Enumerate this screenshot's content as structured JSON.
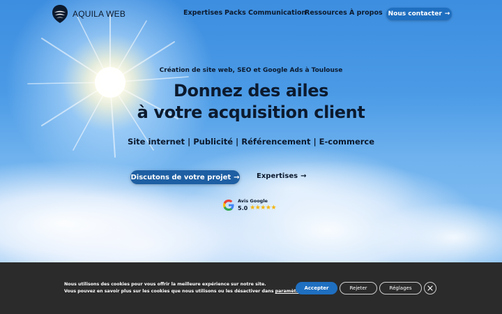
{
  "brand": {
    "name": "AQUILA WEB",
    "logo_icon": "eagle-shield-logo"
  },
  "nav": {
    "items": [
      {
        "label": "Expertises"
      },
      {
        "label": "Packs Communication"
      },
      {
        "label": "Ressources"
      },
      {
        "label": "À propos"
      }
    ],
    "contact_label": "Nous contacter",
    "contact_arrow": "→"
  },
  "hero": {
    "kicker": "Création de site web, SEO et Google Ads à Toulouse",
    "headline_line1": "Donnez des ailes",
    "headline_line2": "à votre acquisition client",
    "services": "Site internet | Publicité | Référencement | E-commerce",
    "cta_primary": "Discutons de votre projet",
    "cta_primary_arrow": "→",
    "cta_secondary": "Expertises",
    "cta_secondary_arrow": "→"
  },
  "review": {
    "label": "Avis Google",
    "score": "5.0",
    "stars": "★★★★★",
    "icon": "google-icon"
  },
  "cookie": {
    "line1": "Nous utilisons des cookies pour vous offrir la meilleure expérience sur notre site.",
    "line2_prefix": "Vous pouvez en savoir plus sur les cookies que nous utilisons ou les désactiver dans",
    "line2_link": "paramètres",
    "line2_suffix": ".",
    "accept_label": "Accepter",
    "reject_label": "Rejeter",
    "settings_label": "Réglages"
  },
  "colors": {
    "accent": "#1f6fc0",
    "text_dark": "#0c1a2e",
    "cookie_bg": "#2b2b2b",
    "star": "#f5b400"
  }
}
